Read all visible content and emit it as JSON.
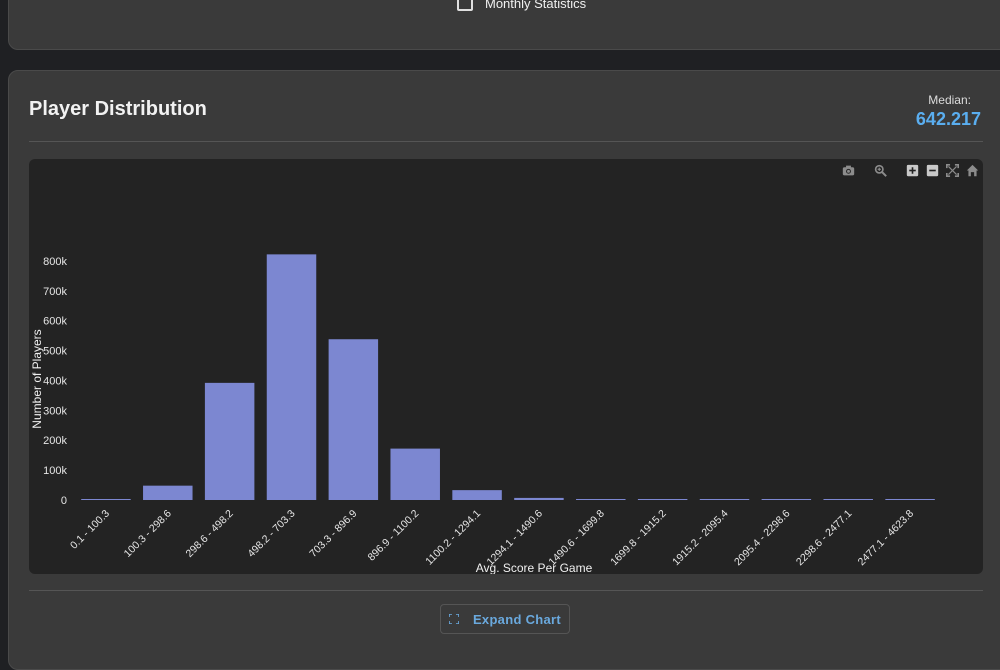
{
  "filters": {
    "monthly_label": "Monthly Statistics"
  },
  "card": {
    "title": "Player Distribution",
    "median_label": "Median:",
    "median_value": "642.217",
    "expand_label": "Expand Chart"
  },
  "colors": {
    "bar": "#7c87d1",
    "accent": "#5aaef0",
    "plot_bg": "#232323"
  },
  "modebar": [
    "camera-icon",
    "zoom-icon",
    "zoom-in-icon",
    "zoom-out-icon",
    "autoscale-icon",
    "home-icon"
  ],
  "chart_data": {
    "type": "bar",
    "title": "",
    "xlabel": "Avg. Score Per Game",
    "ylabel": "Number of Players",
    "categories": [
      "0.1 - 100.3",
      "100.3 - 298.6",
      "298.6 - 498.2",
      "498.2 - 703.3",
      "703.3 - 896.9",
      "896.9 - 1100.2",
      "1100.2 - 1294.1",
      "1294.1 - 1490.6",
      "1490.6 - 1699.8",
      "1699.8 - 1915.2",
      "1915.2 - 2095.4",
      "2095.4 - 2298.6",
      "2298.6 - 2477.1",
      "2477.1 - 4623.8"
    ],
    "values": [
      1000,
      48000,
      392000,
      822000,
      538000,
      172000,
      33000,
      7000,
      1500,
      500,
      300,
      200,
      200,
      100
    ],
    "ylim": [
      0,
      850000
    ],
    "yticks": [
      0,
      100000,
      200000,
      300000,
      400000,
      500000,
      600000,
      700000,
      800000
    ],
    "ytick_labels": [
      "0",
      "100k",
      "200k",
      "300k",
      "400k",
      "500k",
      "600k",
      "700k",
      "800k"
    ],
    "grid": false,
    "legend": "none"
  }
}
